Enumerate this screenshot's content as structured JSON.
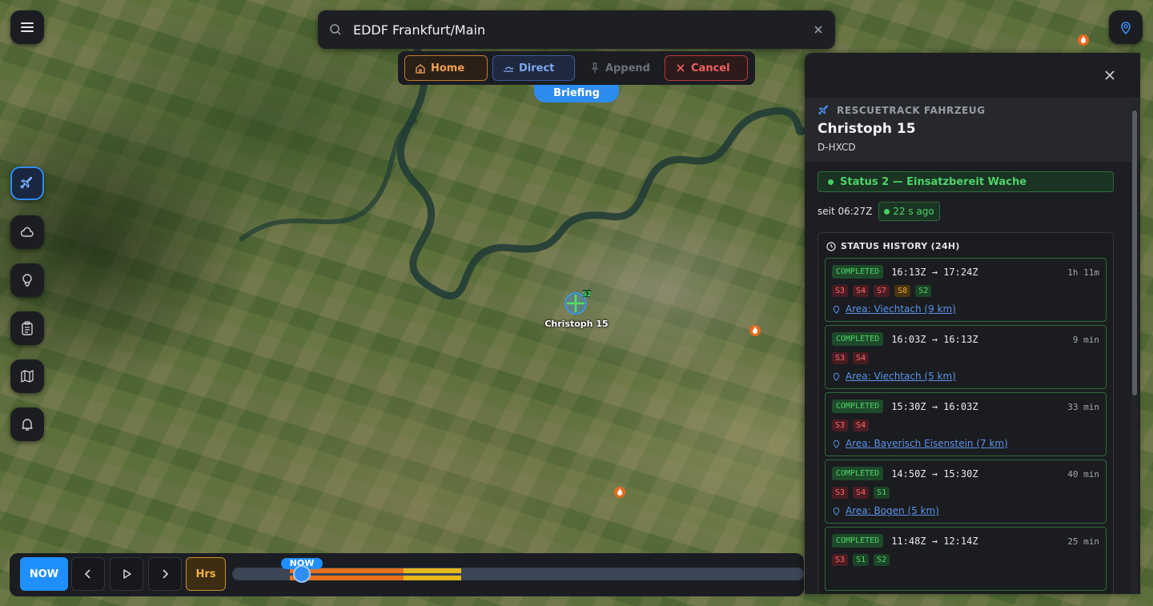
{
  "search": {
    "value": "EDDF Frankfurt/Main"
  },
  "toolbar": {
    "home": "Home",
    "direct": "Direct",
    "append": "Append",
    "cancel": "Cancel"
  },
  "briefing": "Briefing",
  "map": {
    "helicopter_label": "Christoph 15",
    "helicopter_status": "S2"
  },
  "timebar": {
    "now_button": "NOW",
    "hrs_button": "Hrs",
    "now_marker": "NOW"
  },
  "vehicle": {
    "type": "RESCUETRACK FAHRZEUG",
    "name": "Christoph 15",
    "registration": "D-HXCD",
    "status": "Status 2 — Einsatzbereit Wache",
    "since": "seit 06:27Z",
    "age": "22 s ago"
  },
  "history": {
    "title": "STATUS HISTORY (24H)",
    "entries": [
      {
        "state": "COMPLETED",
        "range": "16:13Z → 17:24Z",
        "duration": "1h 11m",
        "tags": [
          "S3",
          "S4",
          "S7",
          "S8",
          "S2"
        ],
        "area": "Area: Viechtach (9 km)"
      },
      {
        "state": "COMPLETED",
        "range": "16:03Z → 16:13Z",
        "duration": "9 min",
        "tags": [
          "S3",
          "S4"
        ],
        "area": "Area: Viechtach (5 km)"
      },
      {
        "state": "COMPLETED",
        "range": "15:30Z → 16:03Z",
        "duration": "33 min",
        "tags": [
          "S3",
          "S4"
        ],
        "area": "Area: Bayerisch Eisenstein (7 km)"
      },
      {
        "state": "COMPLETED",
        "range": "14:50Z → 15:30Z",
        "duration": "40 min",
        "tags": [
          "S3",
          "S4",
          "S1"
        ],
        "area": "Area: Bogen (5 km)"
      },
      {
        "state": "COMPLETED",
        "range": "11:48Z → 12:14Z",
        "duration": "25 min",
        "tags": [
          "S3",
          "S1",
          "S2"
        ],
        "area": ""
      }
    ]
  },
  "colors": {
    "accent": "#1f8fff",
    "success": "#4ed36a",
    "danger": "#ff6b6b",
    "warning": "#f0a830"
  }
}
